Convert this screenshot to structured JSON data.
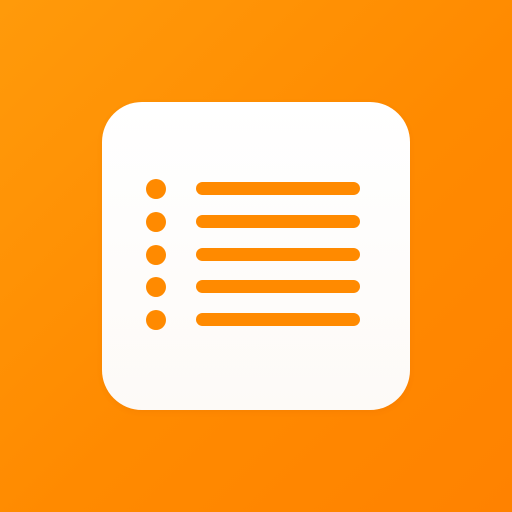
{
  "app_icon": {
    "name": "list-app-icon",
    "icon_name": "list-icon",
    "colors": {
      "background_start": "#FF9A0A",
      "background_end": "#FF8200",
      "card": "#FFFFFF",
      "accent": "#FF8A00"
    },
    "list_item_count": 5
  }
}
